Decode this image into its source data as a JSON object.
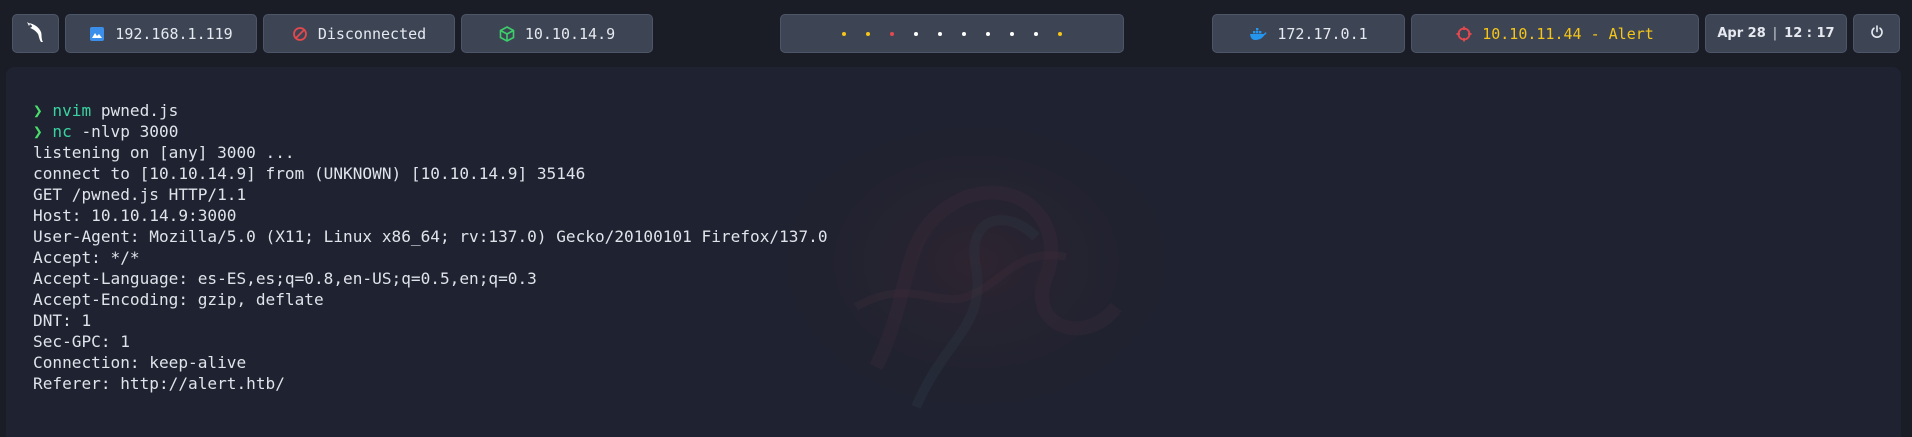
{
  "topbar": {
    "logo_icon": "kali-dragon-icon",
    "local_ip": {
      "icon": "monitor-icon",
      "value": "192.168.1.119",
      "icon_color": "#3b8eea"
    },
    "vpn": {
      "icon": "disconnected-icon",
      "value": "Disconnected",
      "icon_color": "#e5484d"
    },
    "tun_ip": {
      "icon": "cube-icon",
      "value": "10.10.14.9",
      "icon_color": "#3ccf6a"
    },
    "workspaces": [
      {
        "color": "#f5c518"
      },
      {
        "color": "#f5c518"
      },
      {
        "color": "#e5484d"
      },
      {
        "color": "#ffffff"
      },
      {
        "color": "#ffffff"
      },
      {
        "color": "#ffffff"
      },
      {
        "color": "#ffffff"
      },
      {
        "color": "#ffffff"
      },
      {
        "color": "#ffffff"
      },
      {
        "color": "#f5c518"
      }
    ],
    "docker_ip": {
      "icon": "docker-whale-icon",
      "value": "172.17.0.1",
      "icon_color": "#2496ed"
    },
    "target": {
      "icon": "target-icon",
      "value": "10.10.11.44 - Alert",
      "icon_color": "#e5484d",
      "text_color": "#f5c518"
    },
    "clock": {
      "date": "Apr 28",
      "separator": "|",
      "time": "12 : 17"
    },
    "power_icon": "power-icon"
  },
  "terminal": {
    "lines": [
      {
        "prompt": "❯",
        "cmd": "nvim",
        "args": " pwned.js"
      },
      {
        "prompt": "❯",
        "cmd": "nc",
        "args": " -nlvp 3000"
      },
      {
        "text": "listening on [any] 3000 ..."
      },
      {
        "text": "connect to [10.10.14.9] from (UNKNOWN) [10.10.14.9] 35146"
      },
      {
        "text": "GET /pwned.js HTTP/1.1"
      },
      {
        "text": "Host: 10.10.14.9:3000"
      },
      {
        "text": "User-Agent: Mozilla/5.0 (X11; Linux x86_64; rv:137.0) Gecko/20100101 Firefox/137.0"
      },
      {
        "text": "Accept: */*"
      },
      {
        "text": "Accept-Language: es-ES,es;q=0.8,en-US;q=0.5,en;q=0.3"
      },
      {
        "text": "Accept-Encoding: gzip, deflate"
      },
      {
        "text": "DNT: 1"
      },
      {
        "text": "Sec-GPC: 1"
      },
      {
        "text": "Connection: keep-alive"
      },
      {
        "text": "Referer: http://alert.htb/"
      }
    ]
  }
}
